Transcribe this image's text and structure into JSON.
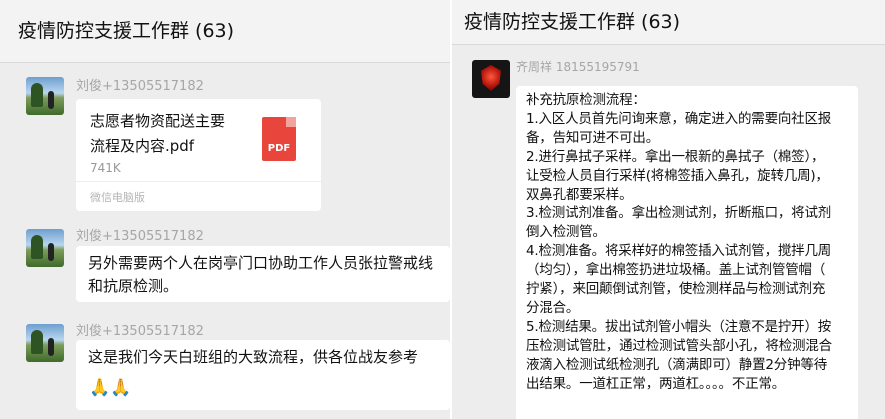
{
  "left_panel": {
    "title": "疫情防控支援工作群 (63)",
    "messages": [
      {
        "sender": "刘俊+13505517182",
        "file": {
          "name_line1": "志愿者物资配送主要",
          "name_line2": "流程及内容.pdf",
          "icon_label": "PDF",
          "size": "741K",
          "source": "微信电脑版"
        }
      },
      {
        "sender": "刘俊+13505517182",
        "line1": "另外需要两个人在岗亭门口协助工作人员张拉警戒线",
        "line2": "和抗原检测。"
      },
      {
        "sender": "刘俊+13505517182",
        "line1": "这是我们今天白班组的大致流程，供各位战友参考",
        "emoji": "🙏🙏"
      }
    ]
  },
  "right_panel": {
    "title": "疫情防控支援工作群 (63)",
    "sender": "齐周祥 18155195791",
    "lines": [
      "补充抗原检测流程：",
      "1.入区人员首先问询来意，确定进入的需要向社区报",
      "备，告知可进不可出。",
      "2.进行鼻拭子采样。拿出一根新的鼻拭子（棉签），",
      "让受检人员自行采样(将棉签插入鼻孔，旋转几周)，",
      "双鼻孔都要采样。",
      "3.检测试剂准备。拿出检测试剂，折断瓶口，将试剂",
      "倒入检测管。",
      "4.检测准备。将采样好的棉签插入试剂管，搅拌几周",
      "（均匀），拿出棉签扔进垃圾桶。盖上试剂管管帽（",
      "拧紧），来回颠倒试剂管，使检测样品与检测试剂充",
      "分混合。",
      "5.检测结果。拔出试剂管小帽头（注意不是拧开）按",
      "压检测试管肚，通过检测试管头部小孔，将检测混合",
      "液滴入检测试纸检测孔（滴满即可）静置2分钟等待",
      "出结果。一道杠正常，两道杠。。。。不正常。"
    ]
  },
  "colors": {
    "background": "#ededed",
    "bubble": "#ffffff",
    "sender": "#a6a6a6",
    "pdf_red": "#e8453c"
  }
}
